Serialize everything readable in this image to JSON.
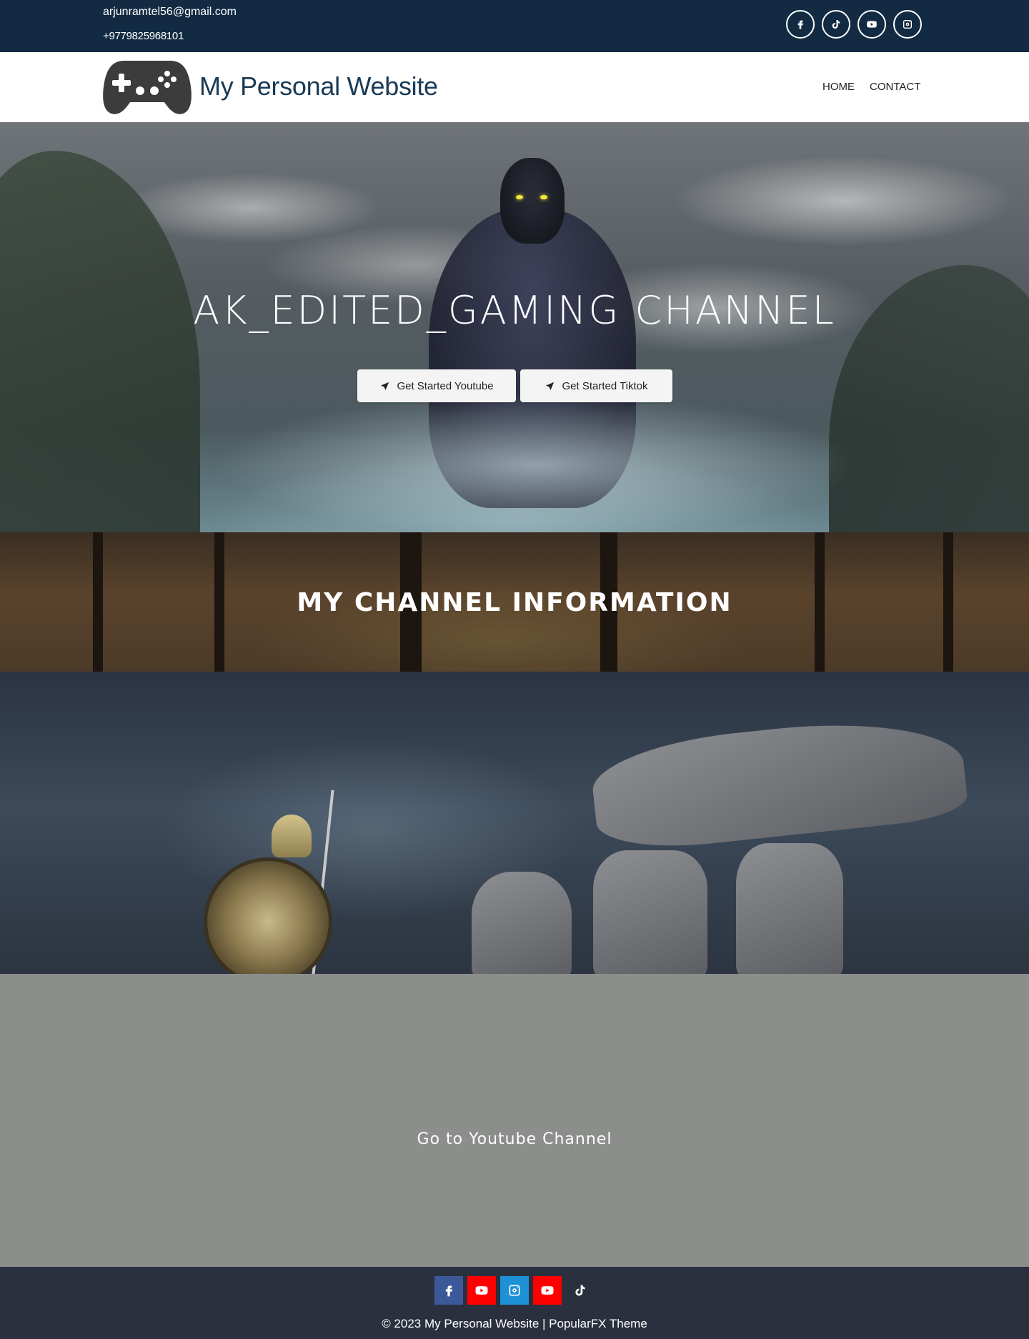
{
  "topbar": {
    "email": "arjunramtel56@gmail.com",
    "phone": "+9779825968101",
    "social": [
      "facebook-icon",
      "tiktok-icon",
      "youtube-icon",
      "instagram-icon"
    ]
  },
  "header": {
    "logo_icon": "gamepad-icon",
    "site_title": "My Personal Website",
    "nav": [
      {
        "label": "HOME"
      },
      {
        "label": "CONTACT"
      }
    ]
  },
  "hero": {
    "title": "AK_EDITED_GAMING CHANNEL",
    "buttons": [
      {
        "label": "Get Started Youtube",
        "icon": "location-arrow-icon"
      },
      {
        "label": "Get Started Tiktok",
        "icon": "location-arrow-icon"
      }
    ]
  },
  "info": {
    "title": "MY CHANNEL INFORMATION"
  },
  "youtube_section": {
    "link_label": "Go to Youtube Channel"
  },
  "footer": {
    "social": [
      {
        "icon": "facebook-icon",
        "color": "#3b5998"
      },
      {
        "icon": "youtube-icon",
        "color": "#ff0000"
      },
      {
        "icon": "instagram-icon",
        "color": "#1e90d6"
      },
      {
        "icon": "youtube-icon",
        "color": "#ff0000"
      },
      {
        "icon": "tiktok-icon",
        "color": "#2a303d"
      }
    ],
    "copyright": "© 2023 My Personal Website | PopularFX Theme"
  },
  "colors": {
    "topbar_bg": "#122b43",
    "title_color": "#1a3a55",
    "footer_bg": "#2a303d",
    "youtube_section_bg": "#8c8e8c"
  }
}
